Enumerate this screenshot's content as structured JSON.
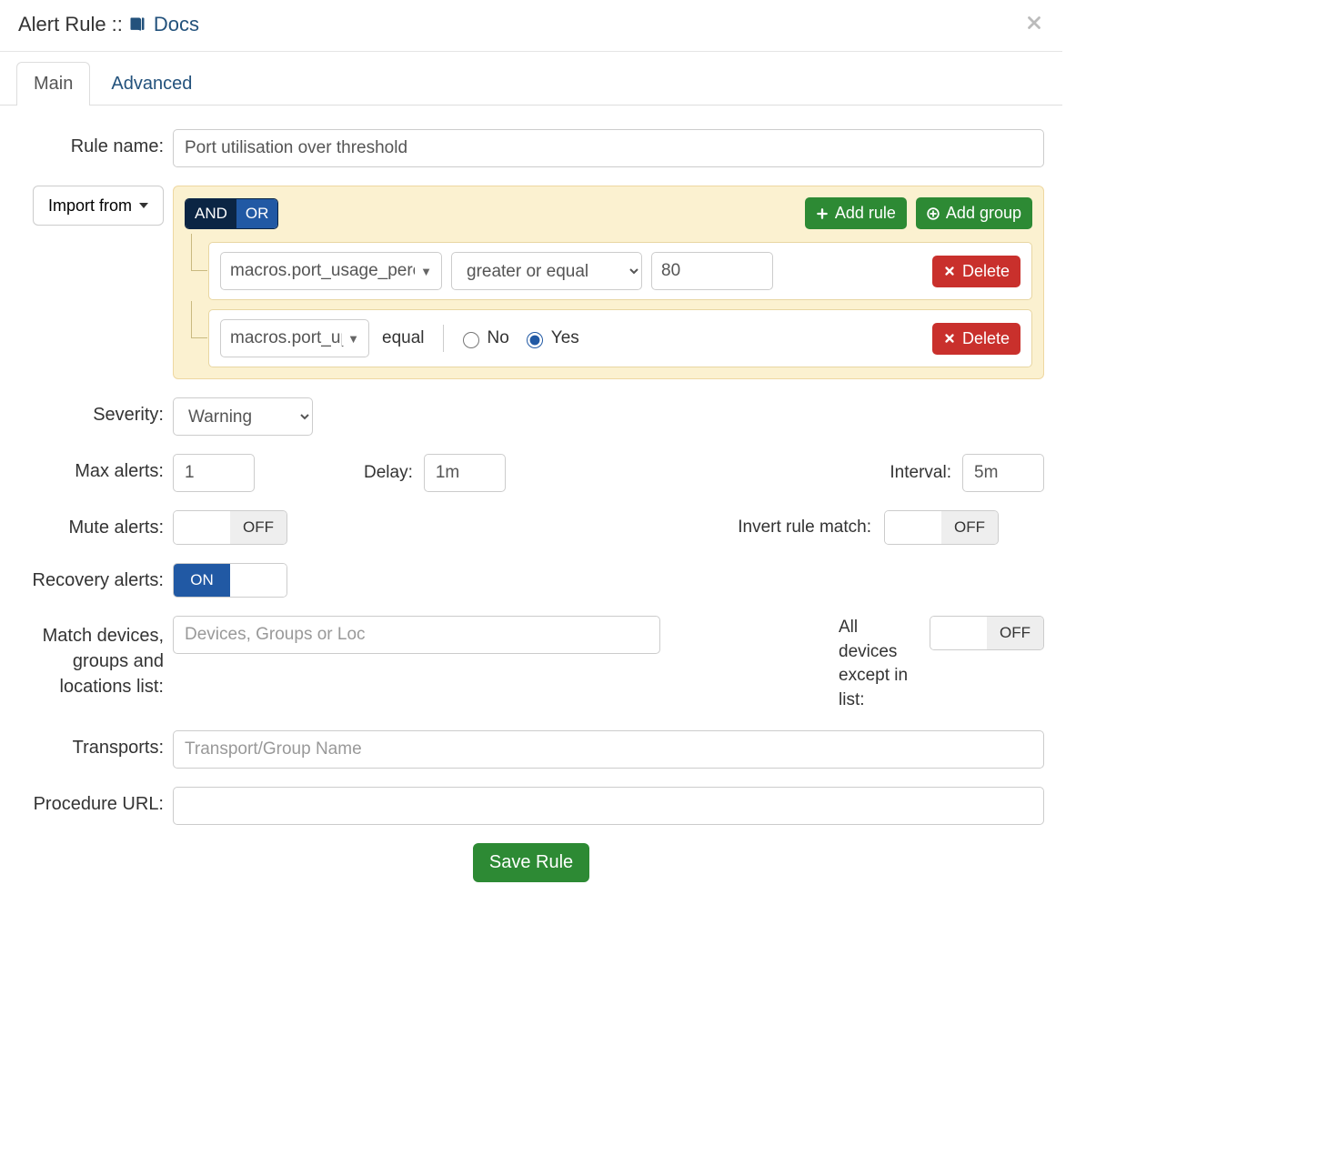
{
  "header": {
    "title": "Alert Rule",
    "sep": "::",
    "docs_label": "Docs"
  },
  "tabs": {
    "main": "Main",
    "advanced": "Advanced"
  },
  "labels": {
    "rule_name": "Rule name:",
    "import_from": "Import from",
    "severity": "Severity:",
    "max_alerts": "Max alerts:",
    "delay": "Delay:",
    "interval": "Interval:",
    "mute": "Mute alerts:",
    "invert": "Invert rule match:",
    "recovery": "Recovery alerts:",
    "match_devices": "Match devices, groups and locations list:",
    "all_except": "All devices except in list:",
    "transports": "Transports:",
    "procedure_url": "Procedure URL:"
  },
  "values": {
    "rule_name": "Port utilisation over threshold",
    "severity": "Warning",
    "max_alerts": "1",
    "delay": "1m",
    "interval": "5m",
    "mute": "OFF",
    "invert": "OFF",
    "recovery": "ON",
    "all_except": "OFF",
    "devices_placeholder": "Devices, Groups or Loc",
    "transports_placeholder": "Transport/Group Name",
    "procedure_url": ""
  },
  "builder": {
    "and": "AND",
    "or": "OR",
    "add_rule": "Add rule",
    "add_group": "Add group",
    "delete": "Delete",
    "rules": [
      {
        "field": "macros.port_usage_perc",
        "operator": "greater or equal",
        "value": "80"
      },
      {
        "field": "macros.port_up",
        "operator": "equal",
        "no": "No",
        "yes": "Yes",
        "selected": "Yes"
      }
    ]
  },
  "buttons": {
    "save": "Save Rule"
  }
}
